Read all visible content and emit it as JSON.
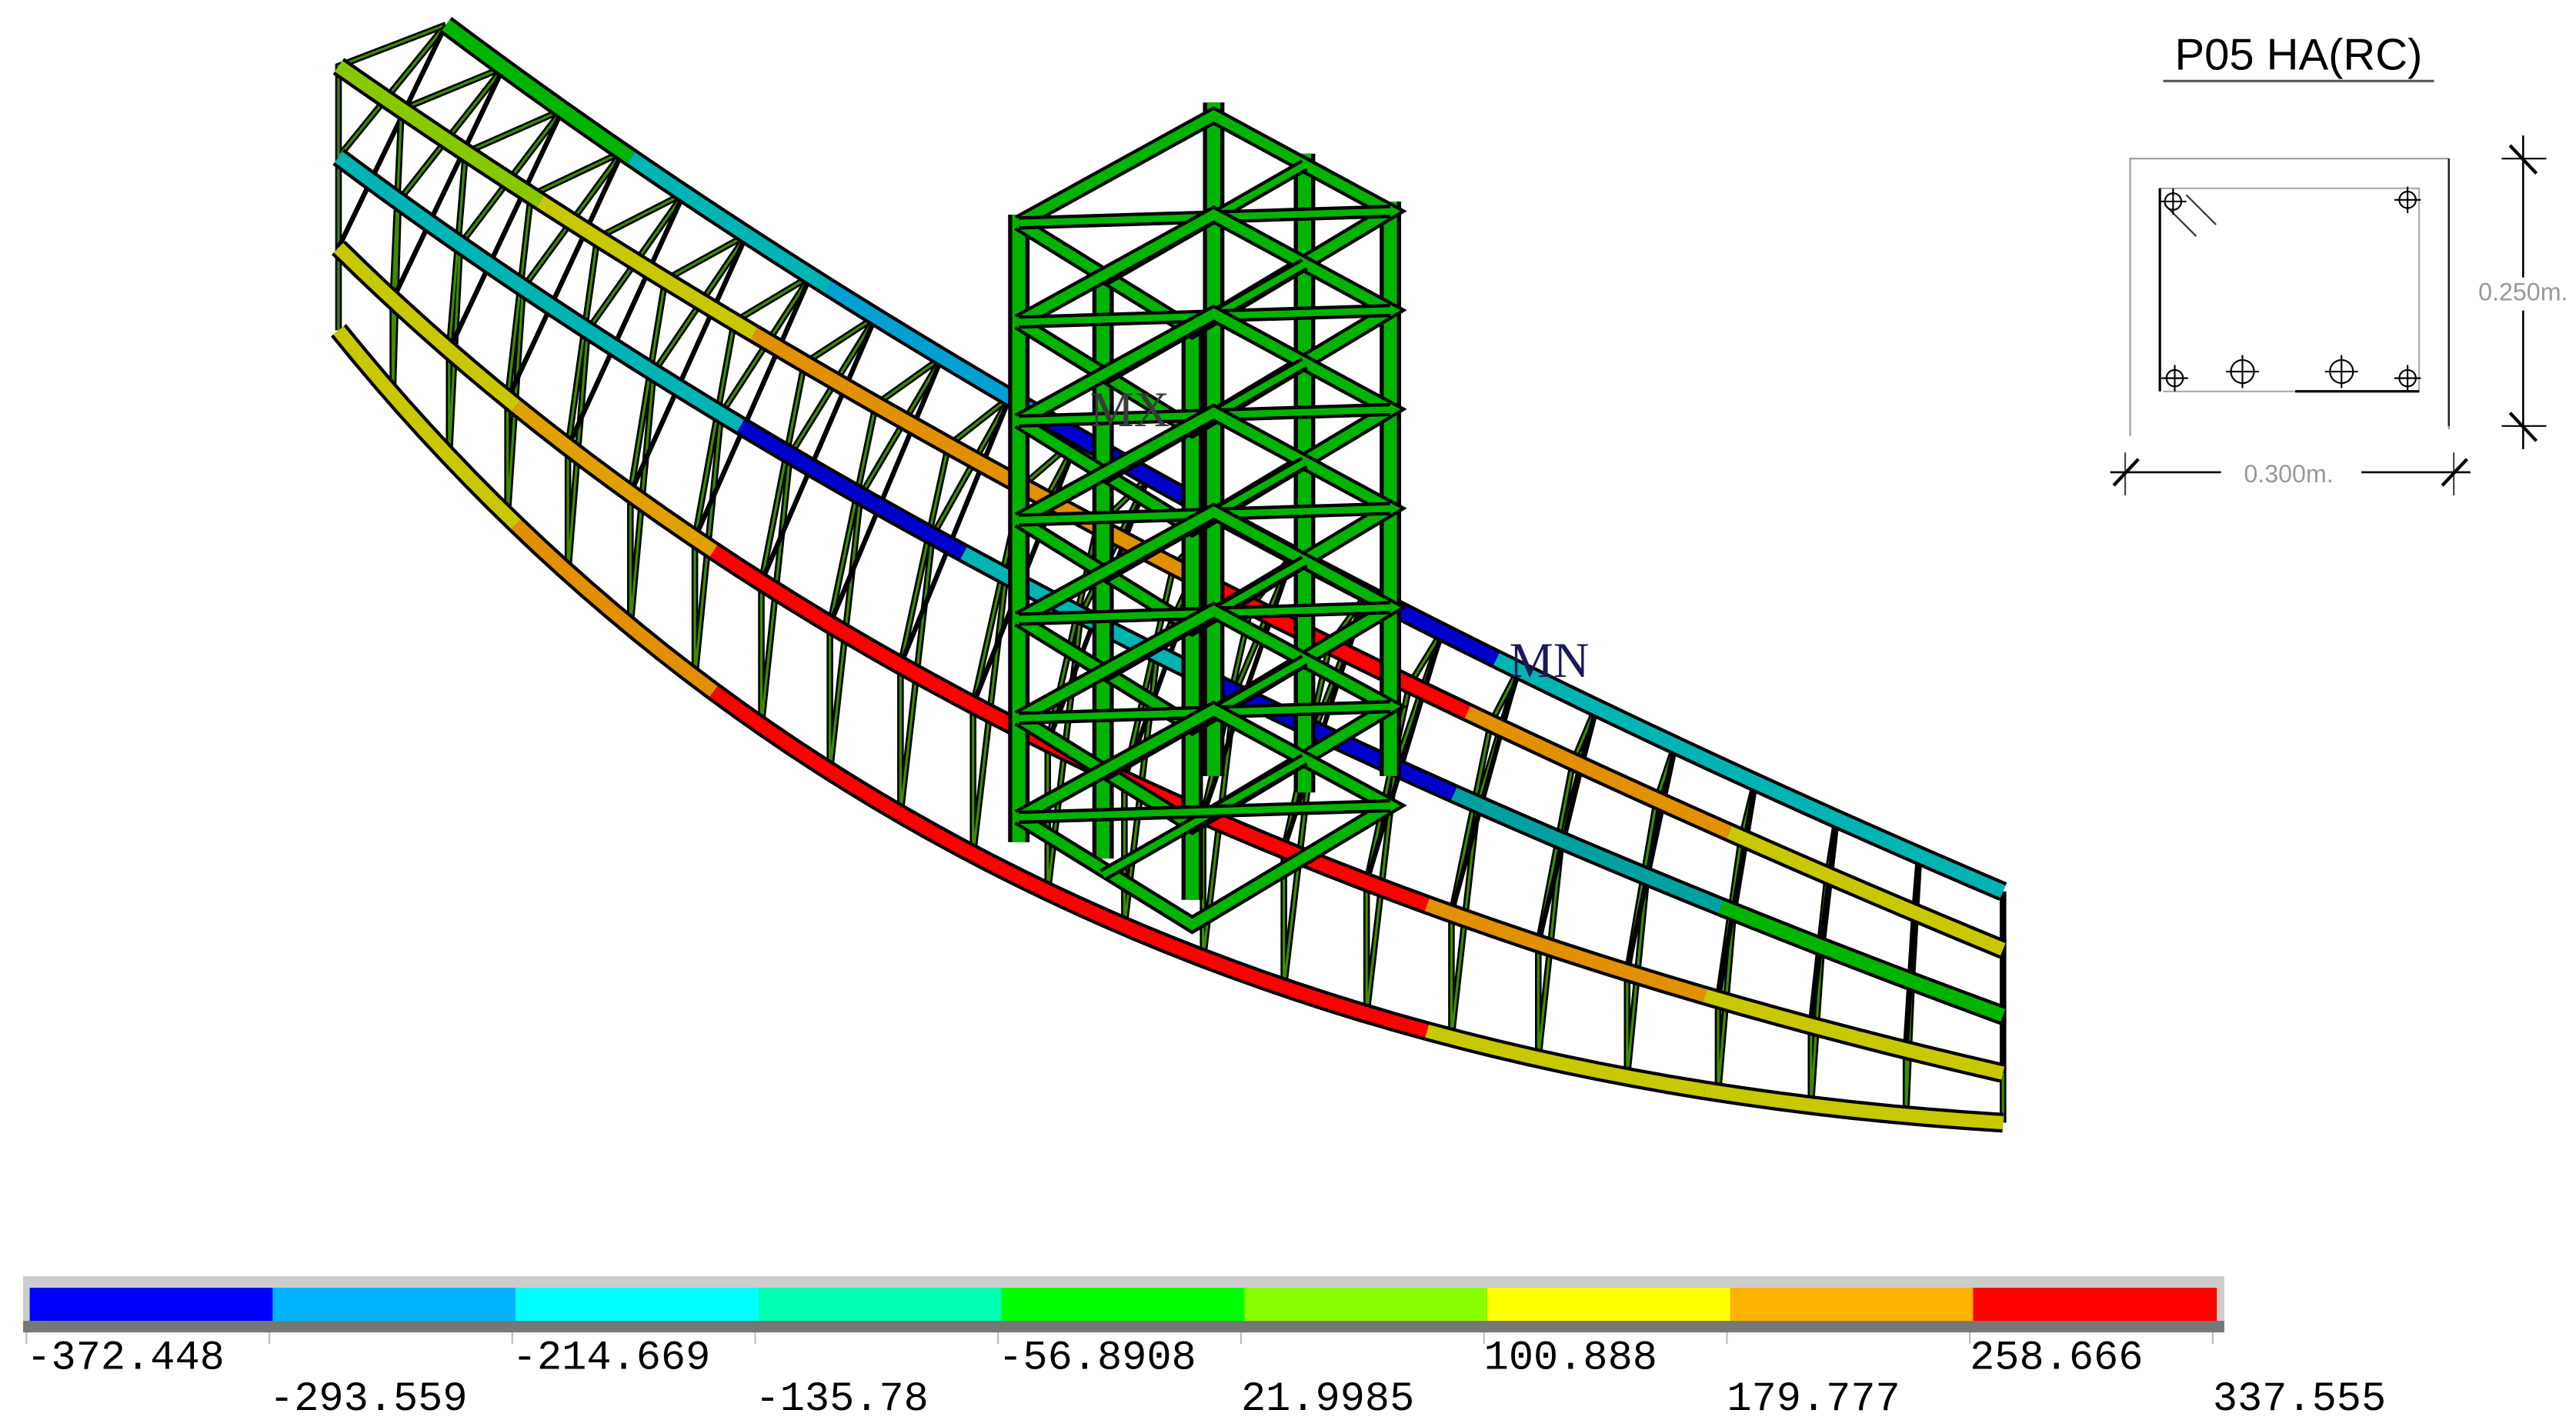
{
  "section": {
    "title": "P05  HA(RC)",
    "height_label": "0.250m.",
    "width_label": "0.300m."
  },
  "markers": {
    "max_label": "MX",
    "min_label": "MN"
  },
  "legend": {
    "colors": [
      "#0000ff",
      "#00b2ff",
      "#00ffff",
      "#00ffb2",
      "#00ff00",
      "#88ff00",
      "#ffff00",
      "#ffb200",
      "#ff0000"
    ],
    "ticks": [
      "-372.448",
      "-293.559",
      "-214.669",
      "-135.78",
      "-56.8908",
      "21.9985",
      "100.888",
      "179.777",
      "258.666",
      "337.555"
    ]
  },
  "model_colors": {
    "column": "#00b400",
    "max_stress": "#ff0000",
    "min_stress": "#0000cc"
  }
}
